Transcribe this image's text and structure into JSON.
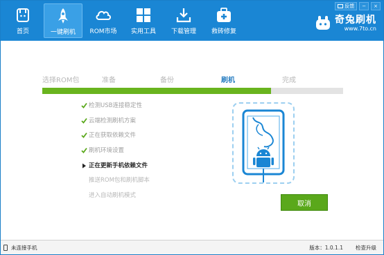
{
  "nav": {
    "items": [
      {
        "label": "首页",
        "icon": "rabbit-home-icon"
      },
      {
        "label": "一键刷机",
        "icon": "rocket-icon",
        "active": true
      },
      {
        "label": "ROM市场",
        "icon": "cloud-icon"
      },
      {
        "label": "实用工具",
        "icon": "grid-icon"
      },
      {
        "label": "下载管理",
        "icon": "download-icon"
      },
      {
        "label": "救砖修复",
        "icon": "first-aid-icon"
      }
    ]
  },
  "topbar": {
    "feedback_label": "反馈",
    "minimize_label": "−",
    "close_label": "×"
  },
  "logo": {
    "title": "奇兔刷机",
    "url": "www.7to.cn"
  },
  "steps": [
    "选择ROM包",
    "准备",
    "备份",
    "刷机",
    "完成"
  ],
  "current_step": 3,
  "progress": 0.76,
  "tasks": [
    {
      "label": "检测USB连接稳定性",
      "status": "done"
    },
    {
      "label": "云端检测刷机方案",
      "status": "done"
    },
    {
      "label": "正在获取依赖文件",
      "status": "done"
    },
    {
      "label": "刷机环境设置",
      "status": "done"
    },
    {
      "label": "正在更新手机依赖文件",
      "status": "current"
    },
    {
      "label": "推送ROM包和刷机脚本",
      "status": "pending"
    },
    {
      "label": "进入自动刷机模式",
      "status": "pending"
    }
  ],
  "cancel_label": "取消",
  "status": {
    "connection": "未连接手机",
    "version": "版本：1.0.1.1",
    "check_update": "检查升级"
  },
  "colors": {
    "header": "#1a86d4",
    "progress_fill": "#69b41e",
    "cancel_button": "#5aa81b",
    "current_step": "#2a7fc2"
  }
}
